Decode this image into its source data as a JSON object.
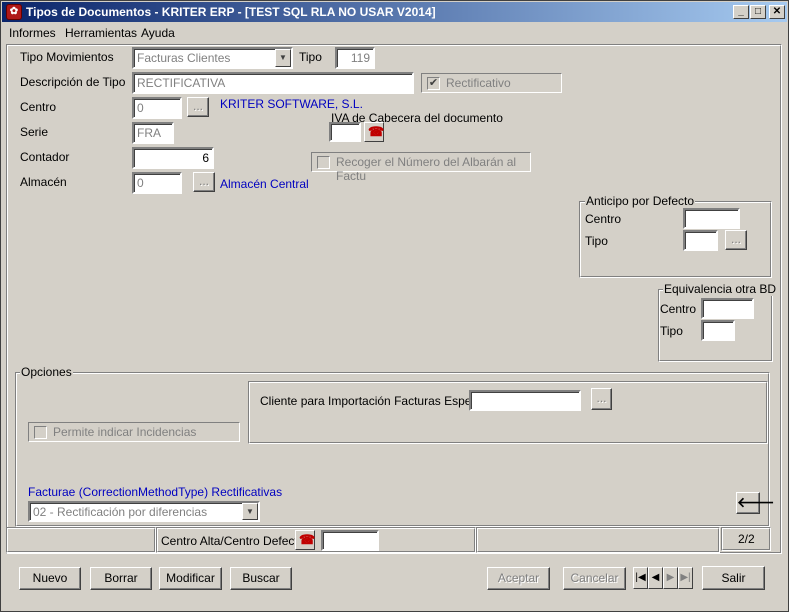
{
  "window": {
    "title": "Tipos de Documentos - KRITER ERP - [TEST SQL RLA NO USAR V2014]",
    "minimize": "_",
    "maximize": "□",
    "close": "✕"
  },
  "menu": {
    "items": [
      "Informes",
      "Herramientas",
      "Ayuda"
    ]
  },
  "form": {
    "tipo_movimientos_label": "Tipo Movimientos",
    "tipo_movimientos_value": "Facturas Clientes",
    "tipo_label": "Tipo",
    "tipo_value": "119",
    "descripcion_label": "Descripción de Tipo",
    "descripcion_value": "RECTIFICATIVA",
    "rectificativo_label": "Rectificativo",
    "centro_label": "Centro",
    "centro_value": "0",
    "centro_name": "KRITER SOFTWARE, S.L.",
    "iva_label": "IVA de Cabecera del documento",
    "serie_label": "Serie",
    "serie_value": "FRA",
    "contador_label": "Contador",
    "contador_value": "6",
    "recoger_label": "Recoger el Número del Albarán al Factu",
    "almacen_label": "Almacén",
    "almacen_value": "0",
    "almacen_name": "Almacén Central",
    "ellipsis": "..."
  },
  "anticipo": {
    "title": "Anticipo por Defecto",
    "centro_label": "Centro",
    "tipo_label": "Tipo"
  },
  "equivalencia": {
    "title": "Equivalencia otra BD",
    "centro_label": "Centro",
    "tipo_label": "Tipo"
  },
  "opciones": {
    "title": "Opciones",
    "cliente_label": "Cliente para Importación Facturas Especiale",
    "incidencias_label": "Permite indicar Incidencias",
    "facturae_label": "Facturae (CorrectionMethodType) Rectificativas",
    "facturae_value": "02 - Rectificación por diferencias",
    "back_arrow": "🡐"
  },
  "status": {
    "centro_alta_label": "Centro Alta/Centro Defecto",
    "record_count": "2/2"
  },
  "buttons": {
    "nuevo": "Nuevo",
    "borrar": "Borrar",
    "modificar": "Modificar",
    "buscar": "Buscar",
    "aceptar": "Aceptar",
    "cancelar": "Cancelar",
    "salir": "Salir"
  }
}
